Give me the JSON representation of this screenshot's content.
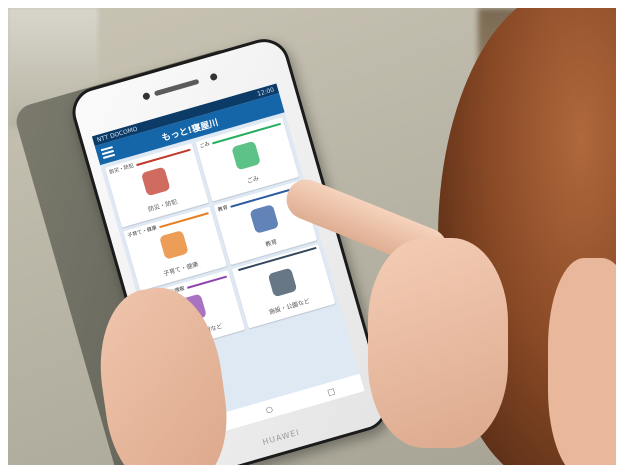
{
  "phone": {
    "brand": "HUAWEI",
    "status_left": "NTT DOCOMO",
    "status_right": "12:00"
  },
  "app": {
    "title": "もっと!寝屋川"
  },
  "tiles": [
    {
      "header": "防災・防犯",
      "label": "防災・防犯",
      "icon": "bear-icon",
      "color": "#c0392b"
    },
    {
      "header": "ごみ",
      "label": "ごみ",
      "icon": "recycle-mascot-icon",
      "color": "#27ae60"
    },
    {
      "header": "子育て・健康",
      "label": "子育て・健康",
      "icon": "baby-icon",
      "color": "#e67e22"
    },
    {
      "header": "教育",
      "label": "教育",
      "icon": "blackboard-icon",
      "color": "#2c5aa0"
    },
    {
      "header": "その他役立ち情報",
      "label": "イベント情報など",
      "icon": "calendar-icon",
      "color": "#8e44ad"
    },
    {
      "header": "",
      "label": "施設・公園など",
      "icon": "building-icon",
      "color": "#34495e"
    }
  ],
  "navbar": {
    "back": "◁",
    "home": "○",
    "recent": "□"
  }
}
